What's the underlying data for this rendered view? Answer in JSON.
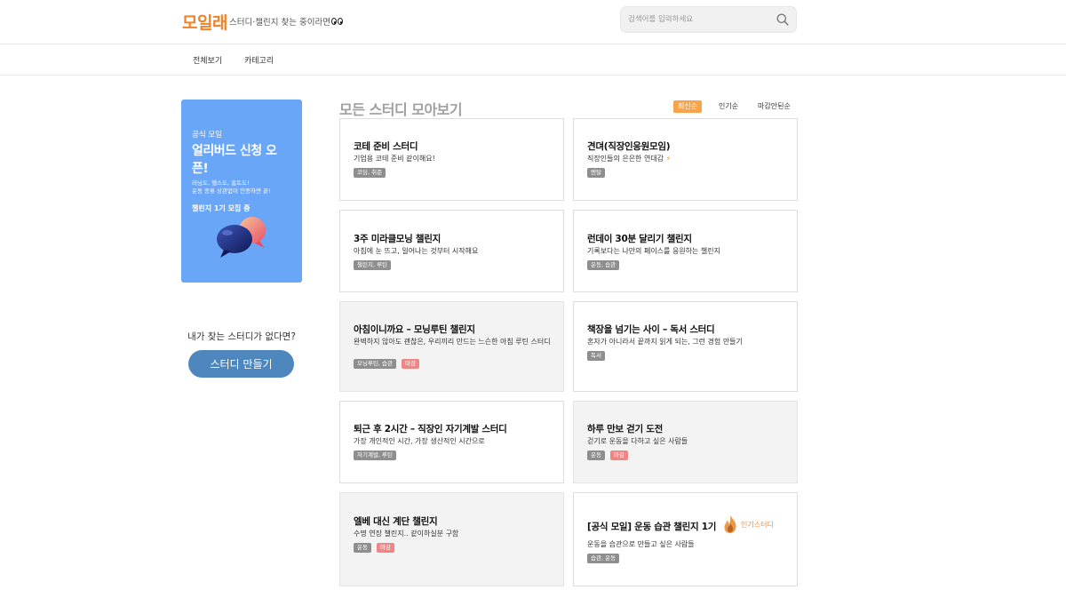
{
  "header": {
    "logo": "모일래",
    "tagline": "스터디·챌린지 찾는 중이라면",
    "search_placeholder": "검색어를 입력하세요"
  },
  "nav": {
    "items": [
      "전체보기",
      "카테고리"
    ]
  },
  "banner": {
    "small": "공식 모일",
    "big": "얼리버드 신청 오픈!",
    "desc_line1": "러닝도, 헬스도, 홈트도!",
    "desc_line2": "운동 종류 상관없이 인증하면 끝!",
    "sub": "챌린지 1기 모집 중"
  },
  "sidebar": {
    "make_label": "내가 찾는 스터디가 없다면?",
    "make_button": "스터디 만들기"
  },
  "main": {
    "title": "모든 스터디 모아보기",
    "sort": [
      "최신순",
      "인기순",
      "마감안된순"
    ],
    "sort_active": "최신순"
  },
  "closed_label": "마감",
  "popular_label": "인기스터디",
  "cards": [
    {
      "title": "코테 준비 스터디",
      "desc": "기업용 코테 준비 같이해요!",
      "tag": "코딩, 취준",
      "closed": false
    },
    {
      "title": "견뎌(직장인응원모임)",
      "desc": "직장인들의 은은한 연대감",
      "tag": "멘탈",
      "closed": false,
      "emoji": "⚡"
    },
    {
      "title": "3주 미라클모닝 챌린지",
      "desc": "아침에 눈 뜨고, 일어나는 것부터 시작해요",
      "tag": "챌린지, 루틴",
      "closed": false
    },
    {
      "title": "런데이 30분 달리기 챌린지",
      "desc": "기록보다는 나만의 페이스를 응원하는 챌린지",
      "tag": "운동, 습관",
      "closed": false
    },
    {
      "title": "아침이니까요 – 모닝루틴 챌린지",
      "desc": "완벽하지 않아도 괜찮은, 우리끼리 만드는 느슨한 아침 루틴 스터디",
      "tag": "모닝루틴, 습관",
      "closed": true
    },
    {
      "title": "책장을 넘기는 사이 – 독서 스터디",
      "desc": "혼자가 아니라서 끝까지 읽게 되는, 그런 경험 만들기",
      "tag": "독서",
      "closed": false
    },
    {
      "title": "퇴근 후 2시간 – 직장인 자기계발 스터디",
      "desc": "가장 개인적인 시간, 가장 생산적인 시간으로",
      "tag": "자기계발, 루틴",
      "closed": false
    },
    {
      "title": "하루 만보 걷기 도전",
      "desc": "걷기로 운동을 다하고 싶은 사람들",
      "tag": "운동",
      "closed": true
    },
    {
      "title": "엘베 대신 계단 챌린지",
      "desc": "수명 연장 챌린지.. 같이하실분 구함",
      "tag": "운동",
      "closed": true
    },
    {
      "title": "[공식 모일] 운동 습관 챌린지 1기",
      "desc": "운동을 습관으로 만들고 싶은 사람들",
      "tag": "습관, 운동",
      "closed": false,
      "popular": true
    }
  ],
  "colors": {
    "brand": "#f0832a",
    "banner": "#6aa6f8",
    "make_button": "#4d87be",
    "sort_active": "#f9a34c",
    "tag": "#8e8e8e",
    "tag_closed": "#f08585"
  },
  "icons": {
    "search": "search-icon",
    "popular": "flame-icon",
    "banner_art": "chat-bubbles-icon",
    "eyes": "eyes-icon"
  }
}
